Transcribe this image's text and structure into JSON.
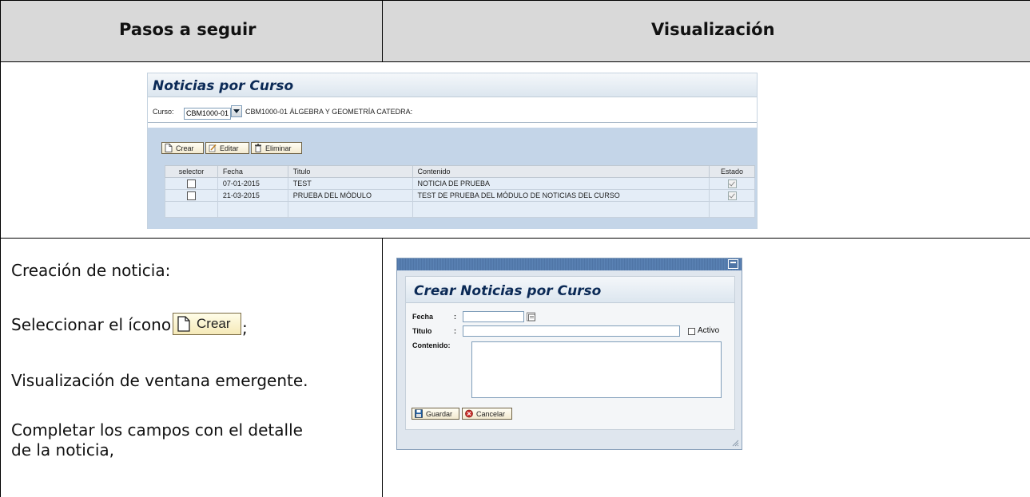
{
  "header": {
    "col1": "Pasos a seguir",
    "col2": "Visualización"
  },
  "screenshot1": {
    "title": "Noticias por Curso",
    "curso_label": "Curso:",
    "curso_value": "CBM1000-01",
    "curso_desc": "CBM1000-01 ÁLGEBRA Y GEOMETRÍA CATEDRA:",
    "buttons": {
      "crear": "Crear",
      "editar": "Editar",
      "eliminar": "Eliminar"
    },
    "columns": [
      "selector",
      "Fecha",
      "Titulo",
      "Contenido",
      "Estado"
    ],
    "rows": [
      {
        "fecha": "07-01-2015",
        "titulo": "TEST",
        "contenido": "NOTICIA DE PRUEBA",
        "estado": true
      },
      {
        "fecha": "21-03-2015",
        "titulo": "PRUEBA DEL MÓDULO",
        "contenido": "TEST DE PRUEBA DEL MÓDULO DE NOTICIAS DEL CURSO",
        "estado": true
      }
    ]
  },
  "steps": {
    "line1": "Creación de noticia:",
    "line2_pre": "Seleccionar el ícono",
    "line2_post": ";",
    "crear_button": "Crear",
    "line3": "Visualización de ventana emergente.",
    "line4a": "Completar los campos con el detalle",
    "line4b": "de la noticia,"
  },
  "popup": {
    "title": "Crear Noticias por Curso",
    "fecha_label": "Fecha",
    "titulo_label": "Titulo",
    "colon": ":",
    "activo_label": "Activo",
    "contenido_label": "Contenido:",
    "guardar": "Guardar",
    "cancelar": "Cancelar"
  }
}
